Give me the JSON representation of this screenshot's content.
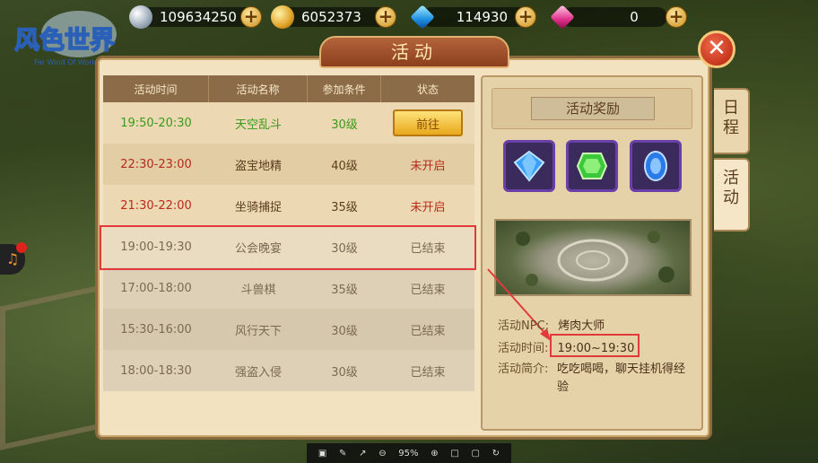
{
  "logo": {
    "text": "风色世界",
    "subtitle": "Far Wind Of World"
  },
  "resources": [
    {
      "icon": "silver-coin-icon",
      "value": "109634250"
    },
    {
      "icon": "gold-coin-icon",
      "value": "6052373"
    },
    {
      "icon": "blue-diamond-icon",
      "value": "114930"
    },
    {
      "icon": "pink-diamond-icon",
      "value": "0"
    }
  ],
  "panel": {
    "title": "活动"
  },
  "side_tabs": [
    {
      "label": "日\n程"
    },
    {
      "label": "活\n动"
    }
  ],
  "table": {
    "headers": [
      "活动时间",
      "活动名称",
      "参加条件",
      "状态"
    ],
    "rows": [
      {
        "time": "19:50-20:30",
        "name": "天空乱斗",
        "level": "30级",
        "status": "前往",
        "state": "active"
      },
      {
        "time": "22:30-23:00",
        "name": "盗宝地精",
        "level": "40级",
        "status": "未开启",
        "state": "pending"
      },
      {
        "time": "21:30-22:00",
        "name": "坐骑捕捉",
        "level": "35级",
        "status": "未开启",
        "state": "pending"
      },
      {
        "time": "19:00-19:30",
        "name": "公会晚宴",
        "level": "30级",
        "status": "已结束",
        "state": "ended"
      },
      {
        "time": "17:00-18:00",
        "name": "斗兽棋",
        "level": "35级",
        "status": "已结束",
        "state": "ended"
      },
      {
        "time": "15:30-16:00",
        "name": "风行天下",
        "level": "30级",
        "status": "已结束",
        "state": "ended"
      },
      {
        "time": "18:00-18:30",
        "name": "强盗入侵",
        "level": "30级",
        "status": "已结束",
        "state": "ended"
      }
    ]
  },
  "detail": {
    "reward_label": "活动奖励",
    "rewards": [
      "blue-gem-icon",
      "green-gem-icon",
      "sapphire-gem-icon"
    ],
    "npc_label": "活动NPC:",
    "npc_value": "烤肉大师",
    "time_label": "活动时间:",
    "time_value": "19:00~19:30",
    "desc_label": "活动简介:",
    "desc_value": "吃吃喝喝，聊天挂机得经验"
  },
  "toolbar": {
    "zoom": "95%"
  },
  "colors": {
    "accent_red": "#e23a3a",
    "active_green": "#3a9a1a",
    "pending_red": "#b62a1a"
  }
}
